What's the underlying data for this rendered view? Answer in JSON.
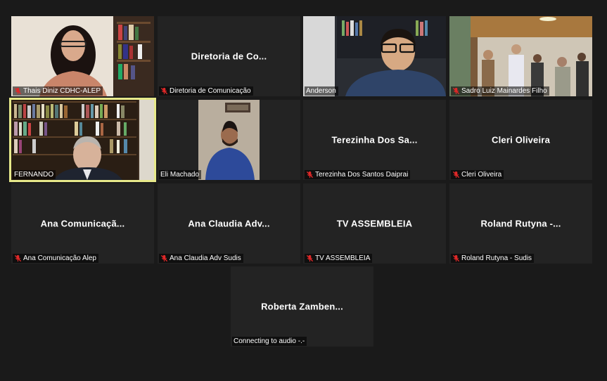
{
  "participants": [
    {
      "display_name": "",
      "label": "Thais Diniz CDHC-ALEP",
      "muted": true
    },
    {
      "display_name": "Diretoria de Co...",
      "label": "Diretoria de Comunicação",
      "muted": true
    },
    {
      "display_name": "",
      "label": "Anderson",
      "muted": false
    },
    {
      "display_name": "",
      "label": "Sadro Luiz Mainardes Filho",
      "muted": true
    },
    {
      "display_name": "",
      "label": "FERNANDO",
      "muted": false
    },
    {
      "display_name": "",
      "label": "Eli Machado",
      "muted": false
    },
    {
      "display_name": "Terezinha Dos Sa...",
      "label": "Terezinha Dos Santos Daiprai",
      "muted": true
    },
    {
      "display_name": "Cleri Oliveira",
      "label": "Cleri Oliveira",
      "muted": true
    },
    {
      "display_name": "Ana  Comunicaçã...",
      "label": "Ana Comunicação Alep",
      "muted": true
    },
    {
      "display_name": "Ana Claudia Adv...",
      "label": "Ana Claudia Adv Sudis",
      "muted": true
    },
    {
      "display_name": "TV ASSEMBLEIA",
      "label": "TV ASSEMBLEIA",
      "muted": true
    },
    {
      "display_name": "Roland  Rutyna  -...",
      "label": "Roland Rutyna - Sudis",
      "muted": true
    },
    {
      "display_name": "Roberta  Zamben...",
      "label": "Connecting to audio -.-",
      "muted": false
    }
  ],
  "colors": {
    "background": "#1a1a1a",
    "tile": "#232323",
    "active_speaker_border": "#e7e98a",
    "mute_icon": "#e02828"
  },
  "icons": {
    "muted": "microphone-muted-icon"
  }
}
